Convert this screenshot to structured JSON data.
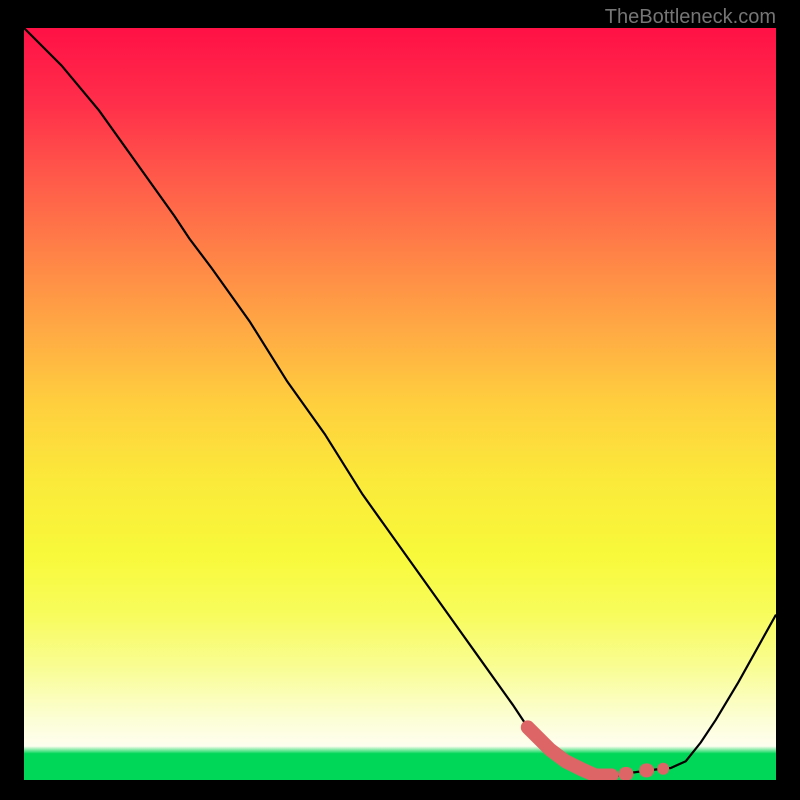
{
  "watermark": "TheBottleneck.com",
  "chart_data": {
    "type": "line",
    "title": "",
    "xlabel": "",
    "ylabel": "",
    "xlim": [
      0,
      100
    ],
    "ylim": [
      0,
      100
    ],
    "series": [
      {
        "name": "main-curve",
        "color": "#000000",
        "x": [
          0,
          5,
          10,
          15,
          20,
          22,
          25,
          30,
          35,
          40,
          45,
          50,
          55,
          60,
          65,
          67,
          70,
          73,
          76,
          79,
          81,
          84,
          86,
          88,
          90,
          92,
          95,
          100
        ],
        "y": [
          100,
          95,
          89,
          82,
          75,
          72,
          68,
          61,
          53,
          46,
          38,
          31,
          24,
          17,
          10,
          7,
          4,
          2,
          0.6,
          0.6,
          1,
          1.4,
          1.6,
          2.5,
          5,
          8,
          13,
          22
        ]
      },
      {
        "name": "highlight-range",
        "color": "#dd6565",
        "style": "dashed-thick",
        "x": [
          67,
          70,
          72,
          74,
          76,
          78,
          80,
          82,
          84,
          85
        ],
        "y": [
          7,
          4,
          2.5,
          1.5,
          0.6,
          0.6,
          0.8,
          1.2,
          1.4,
          1.5
        ]
      }
    ]
  },
  "colors": {
    "bg_border": "#000000",
    "curve": "#000000",
    "highlight": "#dd6565"
  }
}
